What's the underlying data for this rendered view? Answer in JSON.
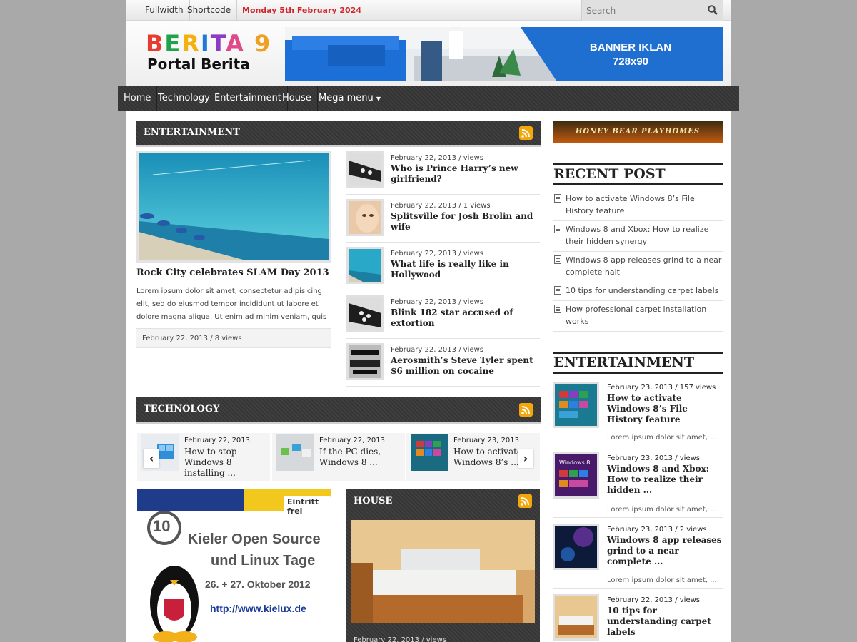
{
  "topbar": {
    "links": [
      "Fullwidth",
      "Shortcode"
    ],
    "date": "Monday 5th February 2024",
    "search_placeholder": "Search"
  },
  "header": {
    "logo_title": "BERITA 9",
    "logo_subtitle": "Portal Berita",
    "banner_line1": "BANNER IKLAN",
    "banner_line2": "728x90"
  },
  "nav": {
    "items": [
      "Home",
      "Technology",
      "Entertainment",
      "House",
      "Mega menu"
    ]
  },
  "entertainment": {
    "heading": "ENTERTAINMENT",
    "featured": {
      "title": "Rock City celebrates SLAM Day 2013",
      "excerpt": "Lorem ipsum dolor sit amet, consectetur adipisicing elit, sed do eiusmod tempor incididunt ut labore et dolore magna aliqua. Ut enim ad minim veniam, quis ...",
      "meta": "February 22, 2013 / 8 views"
    },
    "list": [
      {
        "meta": "February 22, 2013 / views",
        "title": "Who is Prince Harry’s new girlfriend?"
      },
      {
        "meta": "February 22, 2013 / 1 views",
        "title": "Splitsville for Josh Brolin and wife"
      },
      {
        "meta": "February 22, 2013 / views",
        "title": "What life is really like in Hollywood"
      },
      {
        "meta": "February 22, 2013 / views",
        "title": "Blink 182 star accused of extortion"
      },
      {
        "meta": "February 22, 2013 / views",
        "title": "Aerosmith’s Steve Tyler spent $6 million on cocaine"
      }
    ]
  },
  "technology": {
    "heading": "TECHNOLOGY",
    "carousel": [
      {
        "date": "February 22, 2013",
        "title": "How to stop Windows 8 installing ..."
      },
      {
        "date": "February 22, 2013",
        "title": "If the PC dies, Windows 8 ..."
      },
      {
        "date": "February 23, 2013",
        "title": "How to activate Windows 8’s ..."
      }
    ]
  },
  "kiel_ad": {
    "badge": "Eintritt frei",
    "number": "10",
    "line1": "Kieler Open Source",
    "line2": "und Linux Tage",
    "dates": "26. + 27. Oktober 2012",
    "url": "http://www.kielux.de"
  },
  "house": {
    "heading": "HOUSE",
    "meta": "February 22, 2013 / views"
  },
  "sidebar": {
    "ad_text": "HONEY BEAR PLAYHOMES",
    "recent_heading": "RECENT POST",
    "recent": [
      "How to activate Windows 8’s File History feature",
      "Windows 8 and Xbox: How to realize their hidden synergy",
      "Windows 8 app releases grind to a near complete halt",
      "10 tips for understanding carpet labels",
      "How professional carpet installation works"
    ],
    "ent_heading": "ENTERTAINMENT",
    "ent": [
      {
        "meta": "February 23, 2013 / 157 views",
        "title": "How to activate Windows 8’s File History feature",
        "excerpt": "Lorem ipsum dolor sit amet, ..."
      },
      {
        "meta": "February 23, 2013 / views",
        "title": "Windows 8 and Xbox: How to realize their hidden ...",
        "excerpt": "Lorem ipsum dolor sit amet, ..."
      },
      {
        "meta": "February 23, 2013 / 2 views",
        "title": "Windows 8 app releases grind to a near complete ...",
        "excerpt": "Lorem ipsum dolor sit amet, ..."
      },
      {
        "meta": "February 22, 2013 / views",
        "title": "10 tips for understanding carpet labels",
        "excerpt": ""
      }
    ],
    "win8_label": "Windows 8"
  },
  "colors": {
    "accent_red": "#d0262b",
    "rss_orange": "#f4a70b",
    "nav_dark": "#3a3a3a",
    "banner_blue": "#1f6fd0"
  }
}
